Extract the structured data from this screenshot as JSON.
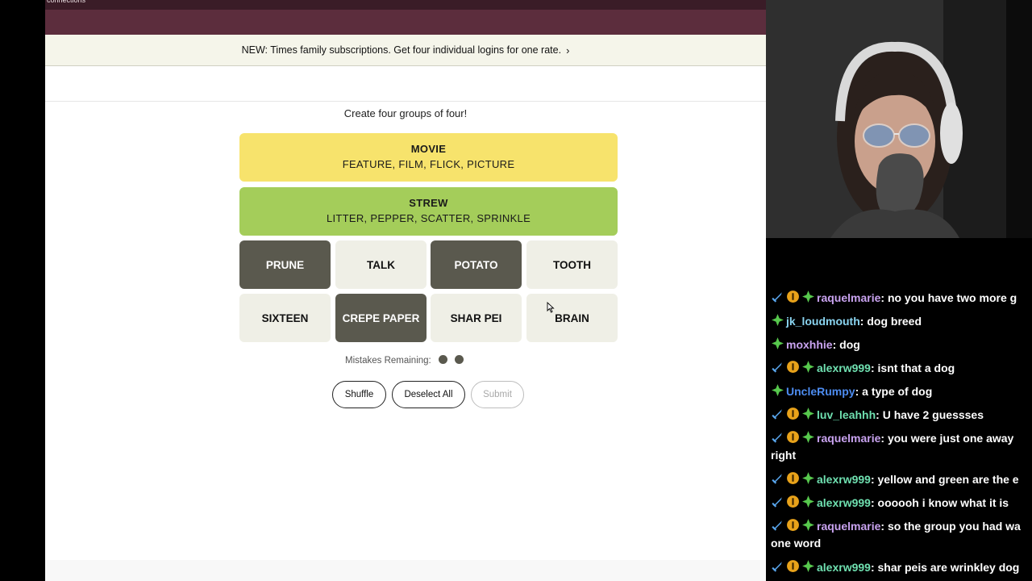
{
  "header": {
    "site_label": "connections"
  },
  "banner": {
    "text": "NEW: Times family subscriptions. Get four individual logins for one rate.",
    "chevron": "›"
  },
  "game": {
    "instructions": "Create four groups of four!",
    "solved": [
      {
        "category": "MOVIE",
        "words": "FEATURE, FILM, FLICK, PICTURE",
        "color": "#f7e36c"
      },
      {
        "category": "STREW",
        "words": "LITTER, PEPPER, SCATTER, SPRINKLE",
        "color": "#a4cd5a"
      }
    ],
    "tiles": [
      {
        "label": "PRUNE",
        "selected": true
      },
      {
        "label": "TALK",
        "selected": false
      },
      {
        "label": "POTATO",
        "selected": true
      },
      {
        "label": "TOOTH",
        "selected": false
      },
      {
        "label": "SIXTEEN",
        "selected": false
      },
      {
        "label": "CREPE PAPER",
        "selected": true
      },
      {
        "label": "SHAR PEI",
        "selected": false
      },
      {
        "label": "BRAIN",
        "selected": false
      }
    ],
    "mistakes_label": "Mistakes Remaining:",
    "mistakes_remaining": 2,
    "buttons": {
      "shuffle": "Shuffle",
      "deselect": "Deselect All",
      "submit": "Submit"
    }
  },
  "chat": {
    "messages": [
      {
        "user": "raquelmarie",
        "user_color": "#c9a3f0",
        "text": "no you have two more g",
        "badges": [
          "sword",
          "one",
          "gem"
        ]
      },
      {
        "user": "jk_loudmouth",
        "user_color": "#8ad4f0",
        "text": "dog breed",
        "badges": [
          "gem"
        ]
      },
      {
        "user": "moxhhie",
        "user_color": "#c9a3f0",
        "text": "dog",
        "badges": [
          "gem"
        ]
      },
      {
        "user": "alexrw999",
        "user_color": "#6fe0b0",
        "text": "isnt that a dog",
        "badges": [
          "sword",
          "one",
          "gem"
        ]
      },
      {
        "user": "UncleRumpy",
        "user_color": "#4d8cf0",
        "text": "a type of dog",
        "badges": [
          "gem"
        ]
      },
      {
        "user": "luv_leahhh",
        "user_color": "#6fe0b0",
        "text": "U have 2 guessses",
        "badges": [
          "sword",
          "one",
          "gem"
        ]
      },
      {
        "user": "raquelmarie",
        "user_color": "#c9a3f0",
        "text": "you were just one away",
        "continuation": "right",
        "badges": [
          "sword",
          "one",
          "gem"
        ]
      },
      {
        "user": "alexrw999",
        "user_color": "#6fe0b0",
        "text": "yellow and green are the e",
        "badges": [
          "sword",
          "one",
          "gem"
        ]
      },
      {
        "user": "alexrw999",
        "user_color": "#6fe0b0",
        "text": "oooooh i know what it is",
        "badges": [
          "sword",
          "one",
          "gem"
        ]
      },
      {
        "user": "raquelmarie",
        "user_color": "#c9a3f0",
        "text": "so the group you had wa",
        "continuation": "one word",
        "badges": [
          "sword",
          "one",
          "gem"
        ]
      },
      {
        "user": "alexrw999",
        "user_color": "#6fe0b0",
        "text": "shar peis are wrinkley dog",
        "badges": [
          "sword",
          "one",
          "gem"
        ]
      }
    ]
  }
}
